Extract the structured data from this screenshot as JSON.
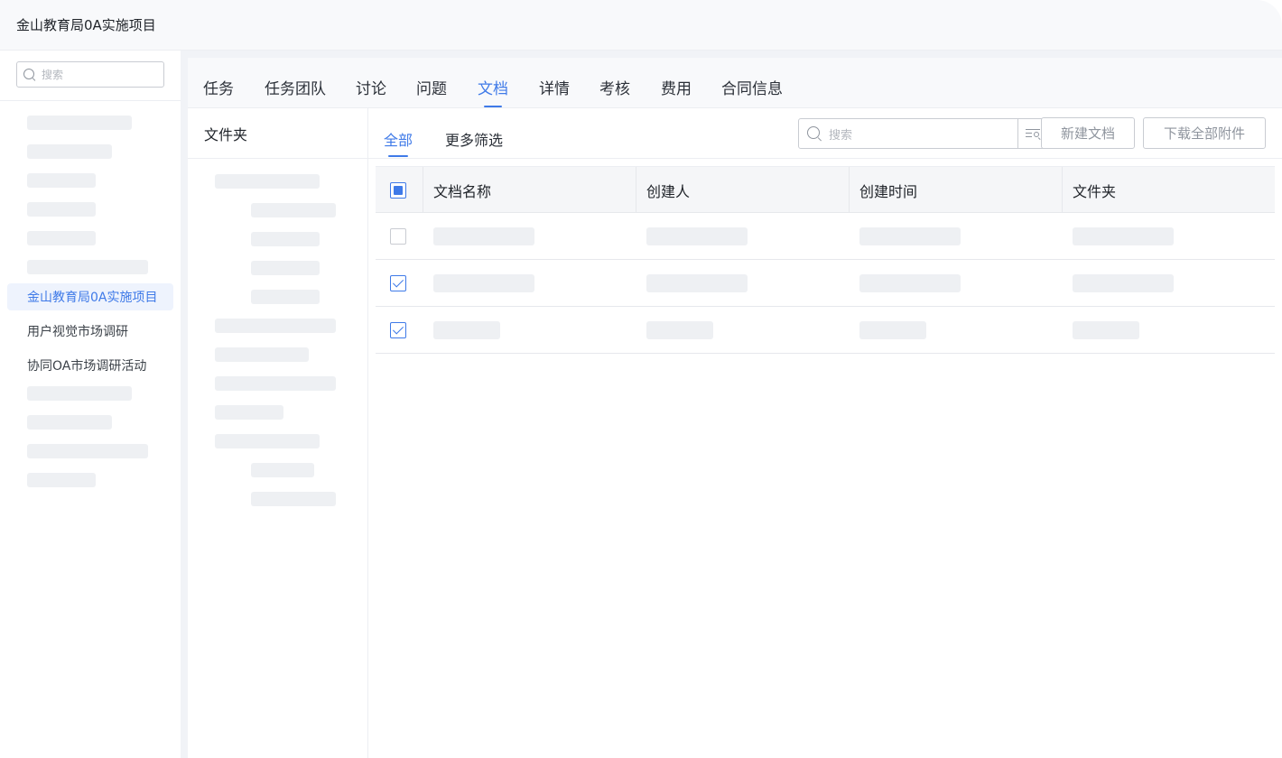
{
  "window": {
    "title": "金山教育局0A实施项目"
  },
  "sidebar": {
    "search_placeholder": "搜索",
    "projects": [
      {
        "label": "金山教育局0A实施项目",
        "active": true
      },
      {
        "label": "用户视觉市场调研",
        "active": false
      },
      {
        "label": "协同OA市场调研活动",
        "active": false
      }
    ]
  },
  "tabs": [
    {
      "label": "任务",
      "active": false
    },
    {
      "label": "任务团队",
      "active": false
    },
    {
      "label": "讨论",
      "active": false
    },
    {
      "label": "问题",
      "active": false
    },
    {
      "label": "文档",
      "active": true
    },
    {
      "label": "详情",
      "active": false
    },
    {
      "label": "考核",
      "active": false
    },
    {
      "label": "费用",
      "active": false
    },
    {
      "label": "合同信息",
      "active": false
    }
  ],
  "folder_panel": {
    "header": "文件夹"
  },
  "doc_toolbar": {
    "sub_tabs": [
      {
        "label": "全部",
        "active": true
      },
      {
        "label": "更多筛选",
        "active": false
      }
    ],
    "search_placeholder": "搜索",
    "new_doc_label": "新建文档",
    "download_all_label": "下载全部附件"
  },
  "table": {
    "columns": [
      "文档名称",
      "创建人",
      "创建时间",
      "文件夹"
    ],
    "header_checkbox": "indeterminate",
    "rows": [
      {
        "checked": false
      },
      {
        "checked": true
      },
      {
        "checked": true
      }
    ]
  },
  "colors": {
    "accent": "#3f7ae8",
    "skeleton": "#eef0f3",
    "border": "#c9ccd2"
  },
  "icons": [
    "search-icon",
    "filter-search-icon",
    "checkbox-icon"
  ]
}
